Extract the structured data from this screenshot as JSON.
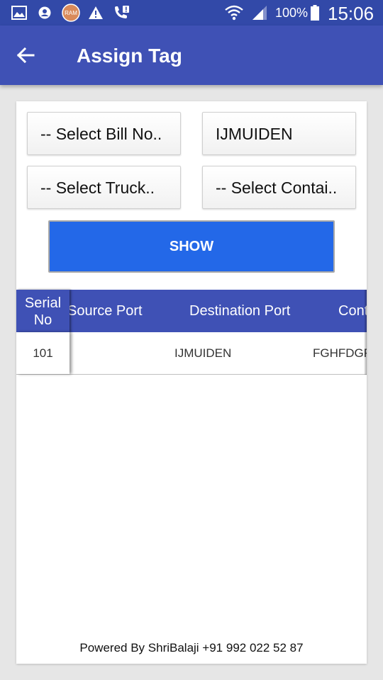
{
  "status_bar": {
    "icons_left": [
      "gallery-icon",
      "account-icon",
      "ram-booster-icon",
      "warning-icon",
      "missed-call-icon"
    ],
    "ram_badge": "RAM",
    "battery_percent": "100%",
    "time": "15:06"
  },
  "app_bar": {
    "title": "Assign Tag"
  },
  "form": {
    "bill_select": "-- Select Bill No..",
    "port_select": "IJMUIDEN",
    "truck_select": "-- Select Truck..",
    "container_select": "-- Select Contai..",
    "show_button": "SHOW"
  },
  "table": {
    "serial_header": [
      "Serial",
      "No"
    ],
    "columns": [
      "Source Port",
      "Destination Port",
      "Cont"
    ],
    "rows": [
      {
        "serial": "101",
        "source_port": "",
        "destination_port": "IJMUIDEN",
        "container": "FGHFDGF"
      }
    ]
  },
  "footer": {
    "text": "Powered By ShriBalaji +91 992 022 52 87"
  },
  "colors": {
    "status_bar": "#3249a8",
    "app_bar": "#3f51b5",
    "table_header": "#3f51b5",
    "button": "#2368e8",
    "background": "#e6e6e6"
  }
}
